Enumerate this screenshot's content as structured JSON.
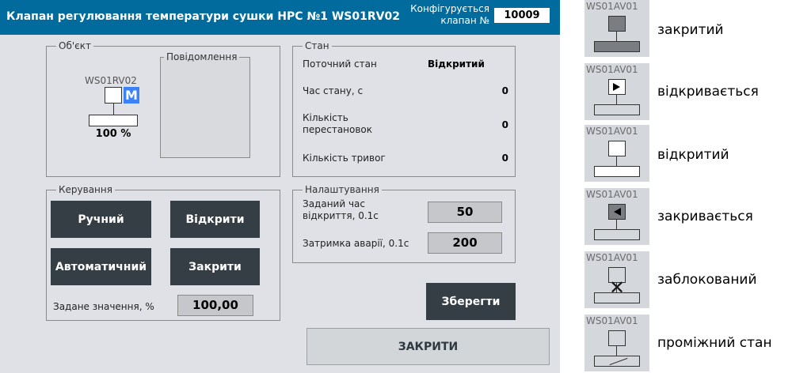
{
  "header": {
    "title": "Клапан регулювання температури сушки НРС №1 WS01RV02",
    "config_label_line1": "Конфігурується",
    "config_label_line2": "клапан №",
    "config_value": "10009"
  },
  "object_panel": {
    "legend": "Об'єкт",
    "tag": "WS01RV02",
    "mode_letter": "M",
    "position": "100 %",
    "messages_legend": "Повідомлення"
  },
  "state_panel": {
    "legend": "Стан",
    "rows": [
      {
        "label": "Поточний стан",
        "value": "Відкритий"
      },
      {
        "label": "Час стану, с",
        "value": "0"
      },
      {
        "label": "Кількість перестановок",
        "value": "0"
      },
      {
        "label": "Кількість тривог",
        "value": "0"
      }
    ]
  },
  "control_panel": {
    "legend": "Керування",
    "manual_button": "Ручний",
    "open_button": "Відкрити",
    "auto_button": "Автоматичний",
    "close_button": "Закрити",
    "setpoint_label": "Задане значення, %",
    "setpoint_value": "100,00"
  },
  "settings_panel": {
    "legend": "Налаштування",
    "open_time_label": "Заданий час відкриття, 0.1с",
    "open_time_value": "50",
    "alarm_delay_label": "Затримка аварії, 0.1с",
    "alarm_delay_value": "200"
  },
  "actions": {
    "save_button": "Зберегти",
    "close_window_button": "ЗАКРИТИ"
  },
  "legend_items": [
    {
      "tag": "WS01AV01",
      "text": "закритий",
      "icon": "valve-closed-icon"
    },
    {
      "tag": "WS01AV01",
      "text": "відкривається",
      "icon": "valve-opening-icon"
    },
    {
      "tag": "WS01AV01",
      "text": "відкритий",
      "icon": "valve-open-icon"
    },
    {
      "tag": "WS01AV01",
      "text": "закривається",
      "icon": "valve-closing-icon"
    },
    {
      "tag": "WS01AV01",
      "text": "заблокований",
      "icon": "valve-blocked-icon"
    },
    {
      "tag": "WS01AV01",
      "text": "проміжний стан",
      "icon": "valve-intermediate-icon"
    }
  ],
  "colors": {
    "header_bg": "#006b9c",
    "panel_bg": "#dfe1e6",
    "button_bg": "#353e44",
    "mode_badge": "#3b82f6"
  }
}
